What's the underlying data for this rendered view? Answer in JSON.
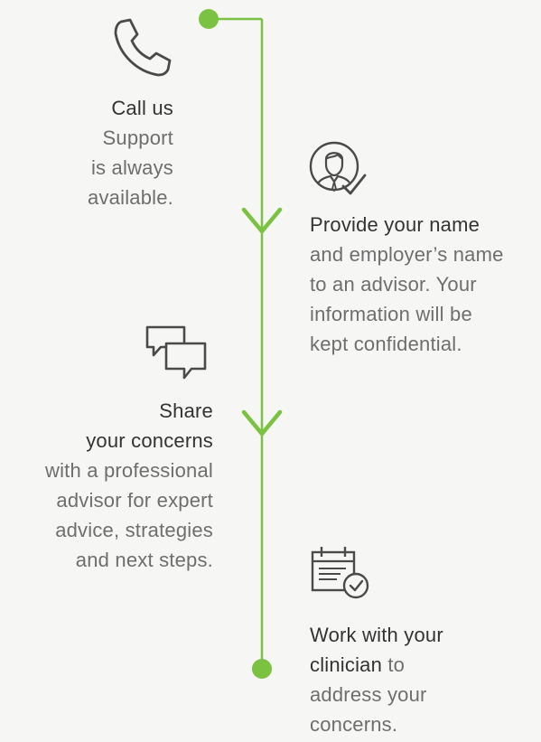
{
  "colors": {
    "accent": "#7cc242",
    "icon": "#4a4a4a",
    "text": "#6e6e6e",
    "heading": "#333333"
  },
  "steps": [
    {
      "icon": "phone-icon",
      "heading": "Call us",
      "lines": [
        "Support",
        "is always",
        "available."
      ]
    },
    {
      "icon": "advisor-icon",
      "heading": "Provide your name",
      "lines": [
        "and employer’s name",
        "to an advisor. Your",
        "information will be",
        "kept confidential."
      ]
    },
    {
      "icon": "chat-bubbles-icon",
      "heading_lines": [
        "Share",
        "your concerns"
      ],
      "lines": [
        "with a professional",
        "advisor for expert",
        "advice, strategies",
        "and next steps."
      ]
    },
    {
      "icon": "calendar-check-icon",
      "heading_bold": "Work with your",
      "heading_bold_2": "clinician",
      "heading_rest": " to",
      "lines": [
        "address your",
        "concerns."
      ]
    }
  ]
}
